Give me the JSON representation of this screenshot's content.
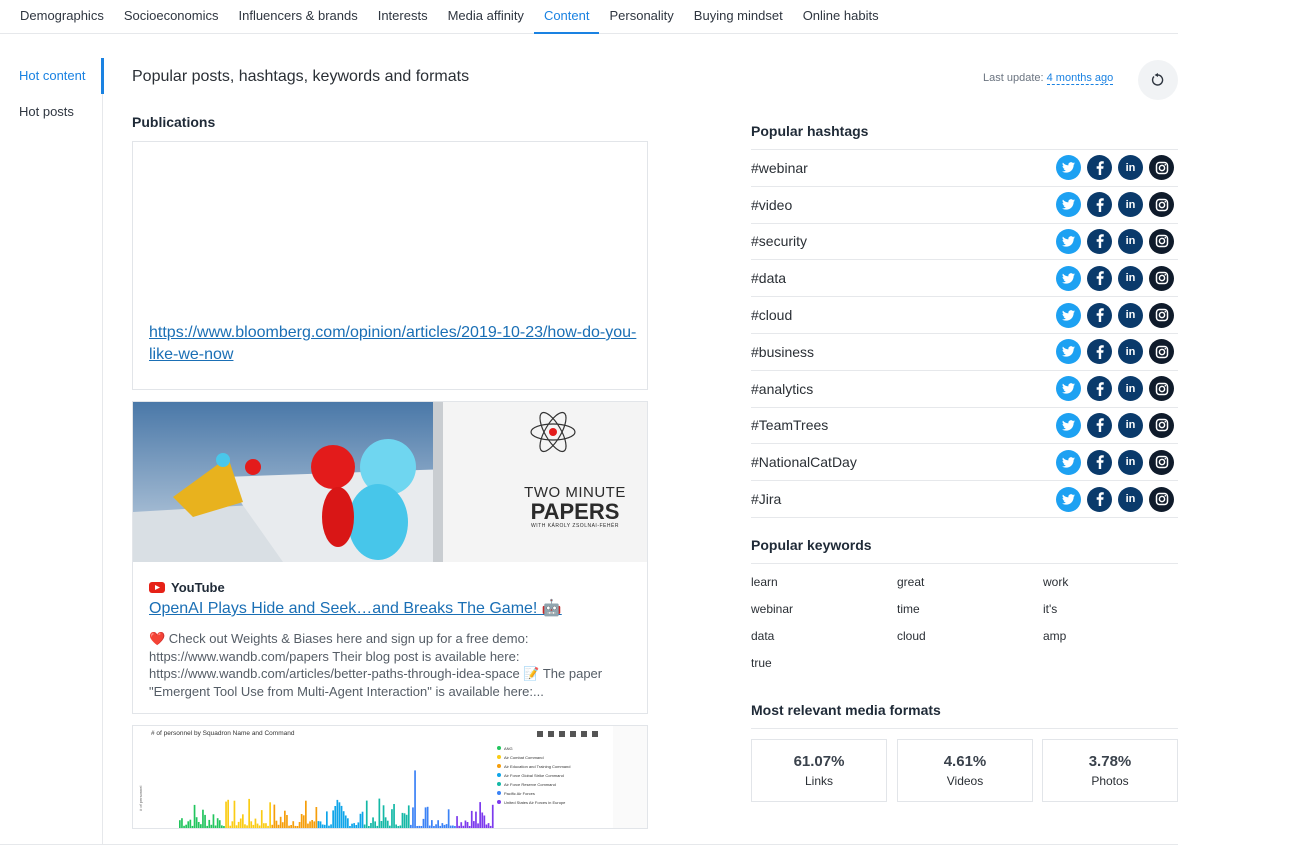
{
  "top_tabs": [
    {
      "label": "Demographics"
    },
    {
      "label": "Socioeconomics"
    },
    {
      "label": "Influencers & brands"
    },
    {
      "label": "Interests"
    },
    {
      "label": "Media affinity"
    },
    {
      "label": "Content",
      "active": true
    },
    {
      "label": "Personality"
    },
    {
      "label": "Buying mindset"
    },
    {
      "label": "Online habits"
    }
  ],
  "side_nav": [
    {
      "label": "Hot content",
      "active": true
    },
    {
      "label": "Hot posts"
    }
  ],
  "header": {
    "title": "Popular posts, hashtags, keywords and formats",
    "last_update_label": "Last update:",
    "last_update_value": "4 months ago",
    "refresh_icon": "refresh-icon"
  },
  "publications": {
    "title": "Publications",
    "card1_link": "https://www.bloomberg.com/opinion/articles/2019-10-23/how-do-you-like-we-now",
    "card2": {
      "source": "YouTube",
      "title": "OpenAI Plays Hide and Seek…and Breaks The Game! 🤖",
      "description": "❤️ Check out Weights & Biases here and sign up for a free demo: https://www.wandb.com/papers Their blog post is available here: https://www.wandb.com/articles/better-paths-through-idea-space 📝 The paper \"Emergent Tool Use from Multi-Agent Interaction\" is available here:...",
      "thumb_line1": "TWO MINUTE",
      "thumb_line2": "PAPERS",
      "thumb_line3": "WITH KÁROLY ZSOLNAI-FEHÉR"
    },
    "card3": {
      "chart_title": "# of personnel by Squadron Name and Command",
      "y_axis_label": "# of personnel",
      "legend": [
        {
          "name": "ANG",
          "color": "#22c55e"
        },
        {
          "name": "Air Combat Command",
          "color": "#facc15"
        },
        {
          "name": "Air Education and Training Command",
          "color": "#f59e0b"
        },
        {
          "name": "Air Force Global Strike Command",
          "color": "#0ea5e9"
        },
        {
          "name": "Air Force Reserve Command",
          "color": "#14b8a6"
        },
        {
          "name": "Pacific Air Forces",
          "color": "#3b82f6"
        },
        {
          "name": "United States Air Forces in Europe",
          "color": "#7c3aed"
        }
      ]
    }
  },
  "hashtags": {
    "title": "Popular hashtags",
    "items": [
      "#webinar",
      "#video",
      "#security",
      "#data",
      "#cloud",
      "#business",
      "#analytics",
      "#TeamTrees",
      "#NationalCatDay",
      "#Jira"
    ],
    "icons": [
      "twitter-icon",
      "facebook-icon",
      "linkedin-icon",
      "instagram-icon"
    ]
  },
  "keywords": {
    "title": "Popular keywords",
    "items": [
      "learn",
      "great",
      "work",
      "webinar",
      "time",
      "it's",
      "data",
      "cloud",
      "amp",
      "true"
    ]
  },
  "media_formats": {
    "title": "Most relevant media formats",
    "items": [
      {
        "percent": "61.07%",
        "label": "Links"
      },
      {
        "percent": "4.61%",
        "label": "Videos"
      },
      {
        "percent": "3.78%",
        "label": "Photos"
      }
    ]
  },
  "colors": {
    "accent": "#1a82e2",
    "link": "#1a6fb5",
    "twitter": "#1da1f2",
    "dark_social": "#0a3a6b"
  }
}
